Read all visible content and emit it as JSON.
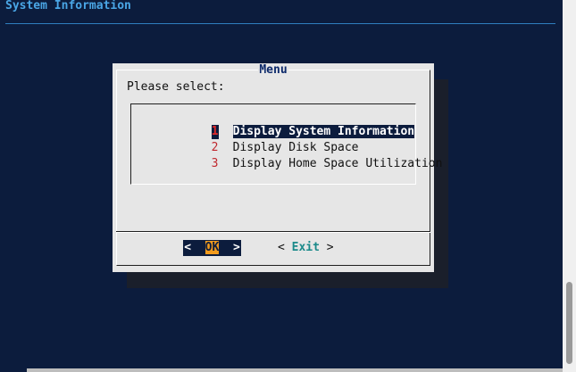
{
  "backtitle": "System Information",
  "dialog": {
    "title": "Menu",
    "prompt": "Please select:",
    "items": [
      {
        "tag": "1",
        "label": "Display System Information",
        "selected": true
      },
      {
        "tag": "2",
        "label": "Display Disk Space",
        "selected": false
      },
      {
        "tag": "3",
        "label": "Display Home Space Utilization",
        "selected": false
      }
    ],
    "ok_label": "OK",
    "exit_label": "Exit",
    "button_left": "<",
    "button_right": ">"
  },
  "colors": {
    "background": "#0c1c3d",
    "dialog": "#e6e6e6",
    "title": "#0d2a6b",
    "tag": "#c0282e",
    "accent": "#f29b1d",
    "exit": "#1b8a8a",
    "backtitle": "#4aa6e6"
  }
}
